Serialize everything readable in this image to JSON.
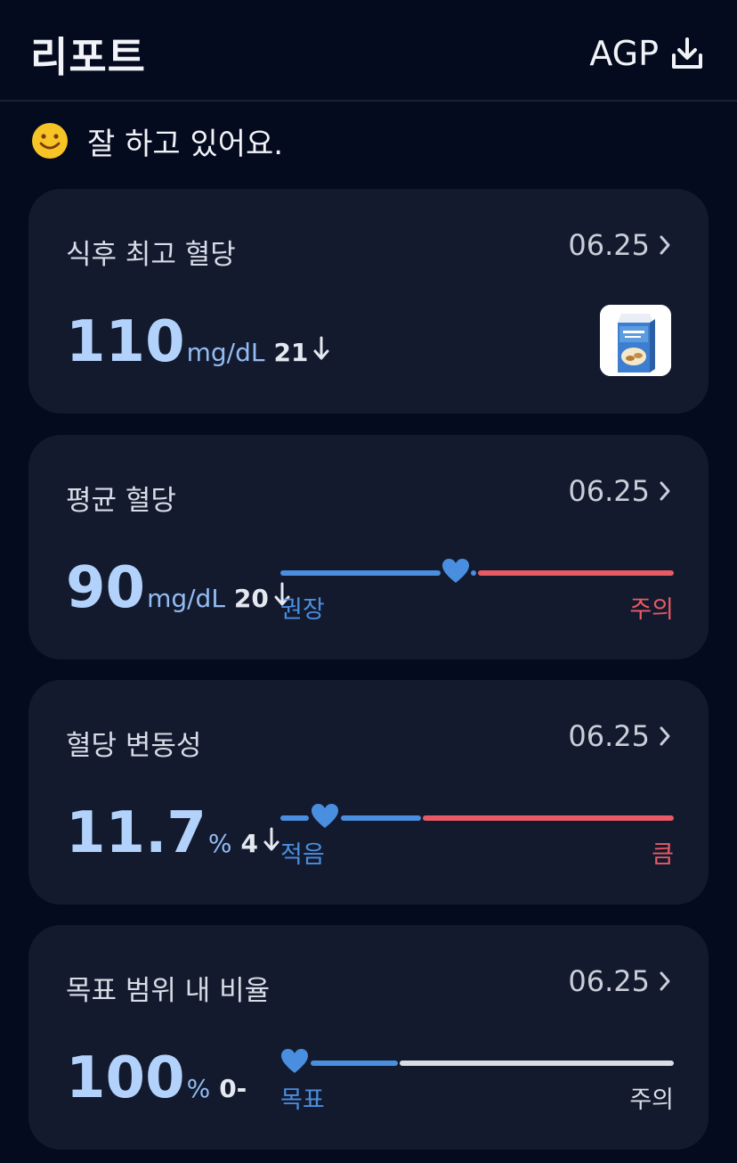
{
  "header": {
    "title": "리포트",
    "agp_label": "AGP"
  },
  "mood": {
    "text": "잘 하고 있어요."
  },
  "cards": [
    {
      "title": "식후 최고 혈당",
      "date": "06.25",
      "value": "110",
      "unit": "mg/dL",
      "delta": "21",
      "food_image": "almond-breeze-carton"
    },
    {
      "title": "평균 혈당",
      "date": "06.25",
      "value": "90",
      "unit": "mg/dL",
      "delta": "20",
      "scale_left": "권장",
      "scale_right": "주의"
    },
    {
      "title": "혈당 변동성",
      "date": "06.25",
      "value": "11.7",
      "unit": "%",
      "delta": "4",
      "scale_left": "적음",
      "scale_right": "큼"
    },
    {
      "title": "목표 범위 내 비율",
      "date": "06.25",
      "value": "100",
      "unit": "%",
      "delta": "0-",
      "scale_left": "목표",
      "scale_right": "주의"
    }
  ],
  "colors": {
    "background": "#050b1e",
    "card": "#131a2e",
    "value": "#b2d2fb",
    "good": "#4a8ee0",
    "warn": "#e85a64",
    "neutral": "#d9dde4"
  }
}
